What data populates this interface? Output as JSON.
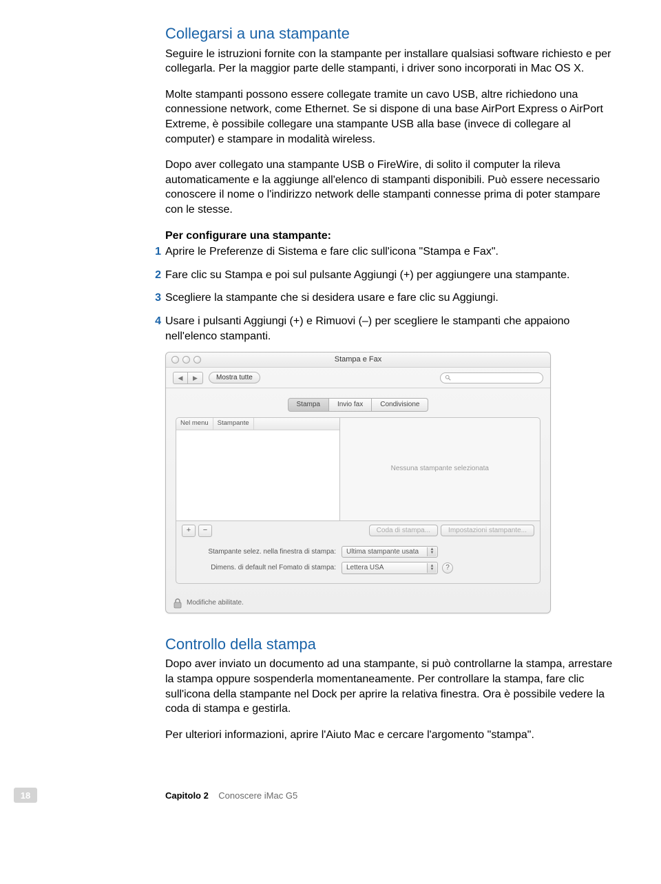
{
  "section1": {
    "title": "Collegarsi a una stampante",
    "p1": "Seguire le istruzioni fornite con la stampante per installare qualsiasi software richiesto e per collegarla. Per la maggior parte delle stampanti, i driver sono incorporati in Mac OS X.",
    "p2": "Molte stampanti possono essere collegate tramite un cavo USB, altre richiedono una connessione network, come Ethernet. Se si dispone di una base AirPort Express o AirPort Extreme, è possibile collegare una stampante USB alla base (invece di collegare al computer) e stampare in modalità wireless.",
    "p3": "Dopo aver collegato una stampante USB o FireWire, di solito il computer la rileva automaticamente e la aggiunge all'elenco di stampanti disponibili. Può essere necessario conoscere il nome o l'indirizzo network delle stampanti connesse prima di poter stampare con le stesse.",
    "steps_title": "Per configurare una stampante:",
    "steps": [
      "Aprire le Preferenze di Sistema e fare clic sull'icona \"Stampa e Fax\".",
      "Fare clic su Stampa e poi sul pulsante Aggiungi (+) per aggiungere una stampante.",
      "Scegliere la stampante che si desidera usare e fare clic su Aggiungi.",
      "Usare i pulsanti Aggiungi (+) e Rimuovi (–) per scegliere le stampanti che appaiono nell'elenco stampanti."
    ]
  },
  "window": {
    "title": "Stampa e Fax",
    "show_all": "Mostra tutte",
    "tabs": {
      "a": "Stampa",
      "b": "Invio fax",
      "c": "Condivisione"
    },
    "col_menu": "Nel menu",
    "col_printer": "Stampante",
    "no_printer": "Nessuna stampante selezionata",
    "queue_btn": "Coda di stampa...",
    "settings_btn": "Impostazioni stampante...",
    "row1_label": "Stampante selez. nella finestra di stampa:",
    "row1_value": "Ultima stampante usata",
    "row2_label": "Dimens. di default nel Fomato di stampa:",
    "row2_value": "Lettera USA",
    "lock_text": "Modifiche abilitate."
  },
  "section2": {
    "title": "Controllo della stampa",
    "p1": "Dopo aver inviato un documento ad una stampante, si può controllarne la stampa, arrestare la stampa oppure sospenderla momentaneamente. Per controllare la stampa, fare clic sull'icona della stampante nel Dock per aprire la relativa finestra. Ora è possibile vedere la coda di stampa e gestirla.",
    "p2": "Per ulteriori informazioni, aprire l'Aiuto Mac e cercare l'argomento \"stampa\"."
  },
  "footer": {
    "page": "18",
    "chapter": "Capitolo 2",
    "title": "Conoscere iMac G5"
  }
}
